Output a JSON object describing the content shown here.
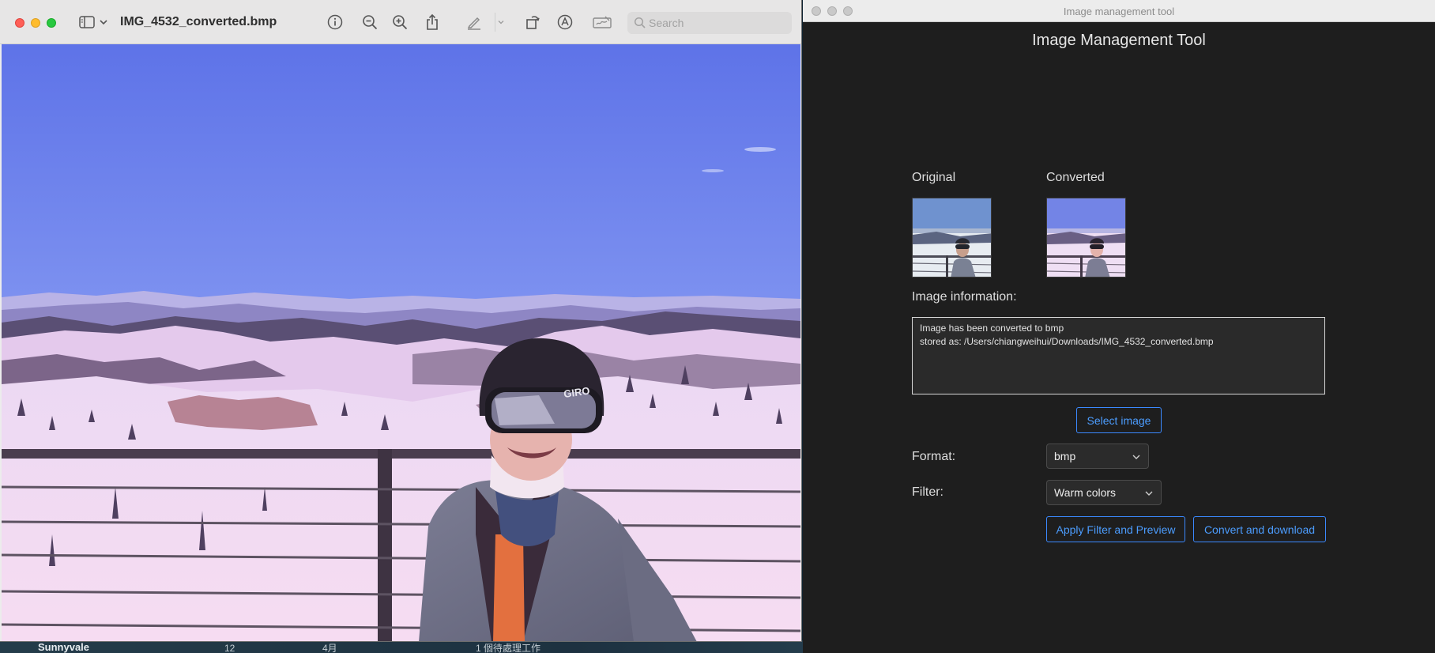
{
  "preview": {
    "title": "IMG_4532_converted.bmp",
    "search_placeholder": "Search",
    "photo_overlay_brand": "GIRO"
  },
  "desktop": {
    "location": "Sunnyvale",
    "clock_number": "12",
    "month": "4月",
    "reminder": "1 個待處理工作"
  },
  "tool": {
    "window_title": "Image management tool",
    "heading": "Image Management Tool",
    "original_label": "Original",
    "converted_label": "Converted",
    "info_label": "Image information:",
    "info_lines": [
      "Image has been converted to bmp",
      "stored as: /Users/chiangweihui/Downloads/IMG_4532_converted.bmp"
    ],
    "select_button": "Select image",
    "format_label": "Format:",
    "format_value": "bmp",
    "filter_label": "Filter:",
    "filter_value": "Warm colors",
    "apply_button": "Apply Filter and Preview",
    "convert_button": "Convert and download"
  },
  "colors": {
    "accent": "#3b89ff",
    "tool_background": "#1e1e1e",
    "close": "#ff5f57",
    "minimize": "#febc2e",
    "zoom": "#28c840"
  },
  "icons": [
    "sidebar-icon",
    "chevron-down-icon",
    "info-icon",
    "zoom-out-icon",
    "zoom-in-icon",
    "share-icon",
    "highlight-pen-icon",
    "rotate-icon",
    "markup-icon",
    "sign-icon",
    "search-icon"
  ]
}
